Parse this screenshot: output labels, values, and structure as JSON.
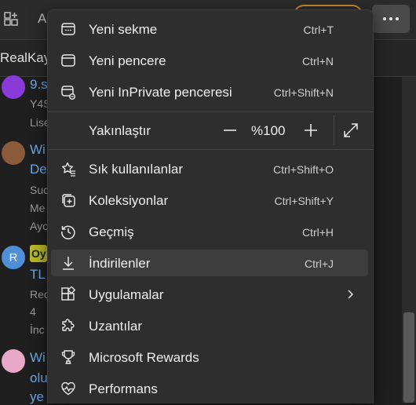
{
  "background": {
    "tab_label": "A",
    "profile_bar_text": "RealKay",
    "items": [
      {
        "title": "9.s",
        "line2": "Y4S",
        "line3": "Lise"
      },
      {
        "title": "Wi",
        "line2": "De",
        "line3": "Suc",
        "line4": "Me",
        "line5": "Ayo"
      },
      {
        "avatar_letter": "R",
        "badge": "Oy",
        "title": "TL",
        "line2": "Rec",
        "line3": "4",
        "line4": "İnc"
      },
      {
        "title": "Wi",
        "line2": "olu",
        "line3": "ye"
      }
    ]
  },
  "menu": {
    "new_tab": {
      "label": "Yeni sekme",
      "shortcut": "Ctrl+T"
    },
    "new_window": {
      "label": "Yeni pencere",
      "shortcut": "Ctrl+N"
    },
    "new_inprivate": {
      "label": "Yeni InPrivate penceresi",
      "shortcut": "Ctrl+Shift+N"
    },
    "zoom": {
      "label": "Yakınlaştır",
      "minus": "—",
      "value": "%100",
      "plus": "+"
    },
    "favorites": {
      "label": "Sık kullanılanlar",
      "shortcut": "Ctrl+Shift+O"
    },
    "collections": {
      "label": "Koleksiyonlar",
      "shortcut": "Ctrl+Shift+Y"
    },
    "history": {
      "label": "Geçmiş",
      "shortcut": "Ctrl+H"
    },
    "downloads": {
      "label": "İndirilenler",
      "shortcut": "Ctrl+J"
    },
    "apps": {
      "label": "Uygulamalar"
    },
    "extensions": {
      "label": "Uzantılar"
    },
    "rewards": {
      "label": "Microsoft Rewards"
    },
    "performance": {
      "label": "Performans"
    }
  },
  "colors": {
    "menu_bg": "#2e2e2e",
    "hover_bg": "#3d3d3d",
    "accent_pill": "#c8892a",
    "link": "#6aa9e8"
  }
}
